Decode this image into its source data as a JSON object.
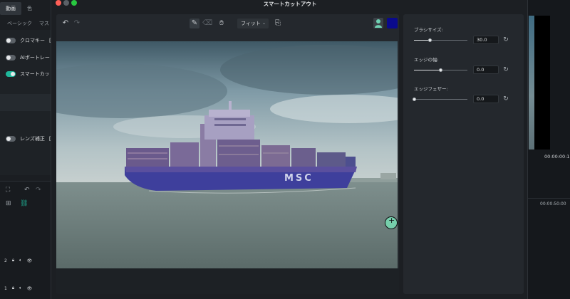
{
  "background": {
    "tabs": [
      "動画",
      "色"
    ],
    "subtabs": [
      "ベーシック",
      "マス"
    ],
    "effects": [
      {
        "label": "クロマキー",
        "suffix": "[",
        "on": false
      },
      {
        "label": "AIポートレー",
        "on": false
      },
      {
        "label": "スマートカッ",
        "on": true
      },
      {
        "label": "レンズ補正",
        "suffix": "[",
        "on": false
      }
    ],
    "tracks": [
      {
        "label": "2"
      },
      {
        "label": "1"
      }
    ],
    "right": {
      "timecode": "00:00:00:1",
      "ruler_time": "00:00:50:00"
    }
  },
  "modal": {
    "title": "スマートカットアウト",
    "toolbar": {
      "fit_label": "フィット",
      "fit_chevron": "⌄",
      "icons": [
        "undo-icon",
        "redo-icon",
        "brush-icon",
        "eraser-icon",
        "hand-icon",
        "preview-icon",
        "person-icon"
      ],
      "overlay_color": "#0a0a8c"
    },
    "settings": {
      "brush_size_label": "ブラシサイズ:",
      "brush_size_value": "30.0",
      "brush_size_fraction": 0.3,
      "edge_thickness_label": "エッジの幅:",
      "edge_thickness_value": "0.0",
      "edge_thickness_fraction": 0.5,
      "edge_feather_label": "エッジフェザー:",
      "edge_feather_value": "0.0",
      "edge_feather_fraction": 0.0
    },
    "ship_text": "MSC"
  },
  "colors": {
    "accent": "#1fb89b",
    "traffic_red": "#ff5f57",
    "traffic_yellow": "#febc2e",
    "traffic_green": "#28c840"
  }
}
